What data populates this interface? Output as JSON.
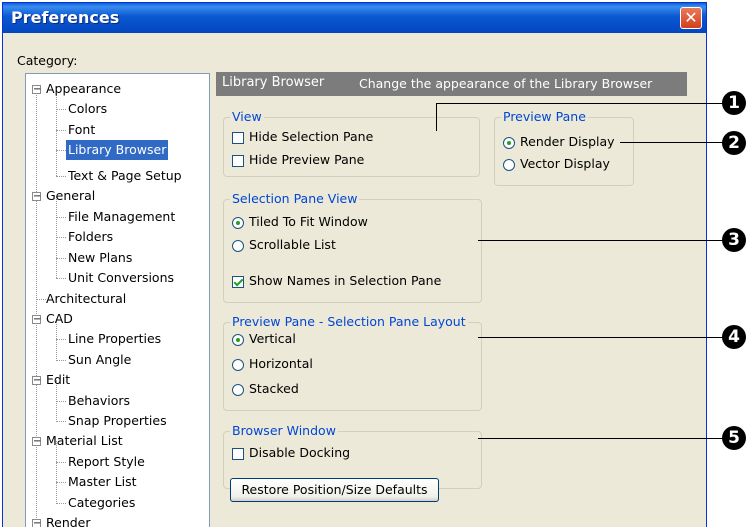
{
  "window": {
    "title": "Preferences",
    "close_glyph": "✕"
  },
  "category_label": "Category:",
  "tree": {
    "nodes": [
      {
        "label": "Appearance",
        "expander": "−"
      },
      {
        "label": "Colors"
      },
      {
        "label": "Font"
      },
      {
        "label": "Library Browser",
        "selected": true
      },
      {
        "label": "Text & Page Setup"
      },
      {
        "label": "General",
        "expander": "−"
      },
      {
        "label": "File Management"
      },
      {
        "label": "Folders"
      },
      {
        "label": "New Plans"
      },
      {
        "label": "Unit Conversions"
      },
      {
        "label": "Architectural"
      },
      {
        "label": "CAD",
        "expander": "−"
      },
      {
        "label": "Line Properties"
      },
      {
        "label": "Sun Angle"
      },
      {
        "label": "Edit",
        "expander": "−"
      },
      {
        "label": "Behaviors"
      },
      {
        "label": "Snap Properties"
      },
      {
        "label": "Material List",
        "expander": "−"
      },
      {
        "label": "Report Style"
      },
      {
        "label": "Master List"
      },
      {
        "label": "Categories"
      },
      {
        "label": "Render",
        "expander": "−"
      }
    ]
  },
  "panel": {
    "title": "Library Browser",
    "description": "Change the appearance of the Library Browser"
  },
  "view_group": {
    "legend": "View",
    "hide_selection_pane": {
      "label": "Hide Selection Pane",
      "checked": false
    },
    "hide_preview_pane": {
      "label": "Hide Preview Pane",
      "checked": false
    }
  },
  "preview_pane_group": {
    "legend": "Preview Pane",
    "render_display": {
      "label": "Render Display",
      "selected": true
    },
    "vector_display": {
      "label": "Vector Display",
      "selected": false
    }
  },
  "selection_pane_view_group": {
    "legend": "Selection Pane View",
    "tiled": {
      "label": "Tiled To Fit Window",
      "selected": true
    },
    "scrollable": {
      "label": "Scrollable List",
      "selected": false
    },
    "show_names": {
      "label": "Show Names in Selection Pane",
      "checked": true
    }
  },
  "layout_group": {
    "legend": "Preview Pane - Selection Pane Layout",
    "vertical": {
      "label": "Vertical",
      "selected": true
    },
    "horizontal": {
      "label": "Horizontal",
      "selected": false
    },
    "stacked": {
      "label": "Stacked",
      "selected": false
    }
  },
  "browser_window_group": {
    "legend": "Browser Window",
    "disable_docking": {
      "label": "Disable Docking",
      "checked": false
    },
    "restore_button": "Restore Position/Size Defaults"
  },
  "callouts": [
    "1",
    "2",
    "3",
    "4",
    "5"
  ]
}
